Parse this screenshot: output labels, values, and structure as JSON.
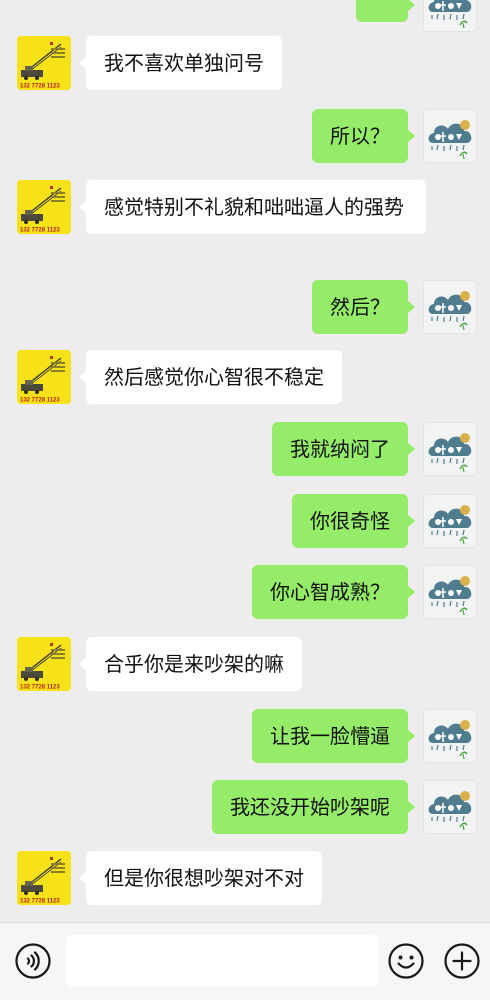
{
  "messages": [
    {
      "side": "left",
      "text": "我不喜欢单独问号"
    },
    {
      "side": "right",
      "text": "所以？"
    },
    {
      "side": "left",
      "text": "感觉特别不礼貌和咄咄逼人的强势"
    },
    {
      "side": "right",
      "text": "然后？"
    },
    {
      "side": "left",
      "text": "然后感觉你心智很不稳定"
    },
    {
      "side": "right",
      "text": "我就纳闷了"
    },
    {
      "side": "right",
      "text": "你很奇怪"
    },
    {
      "side": "right",
      "text": "你心智成熟？"
    },
    {
      "side": "left",
      "text": "合乎你是来吵架的嘛"
    },
    {
      "side": "right",
      "text": "让我一脸懵逼"
    },
    {
      "side": "right",
      "text": "我还没开始吵架呢"
    },
    {
      "side": "left",
      "text": "但是你很想吵架对不对"
    }
  ],
  "contact_avatar": {
    "phone_text": "132 7728 1123"
  },
  "input_bar": {
    "icons": [
      "voice-icon",
      "emoji-icon",
      "plus-icon"
    ],
    "value": ""
  },
  "colors": {
    "chat_bg": "#ededed",
    "self_bubble": "#95ec69",
    "other_bubble": "#ffffff",
    "avatar_yellow": "#f7e21a"
  }
}
